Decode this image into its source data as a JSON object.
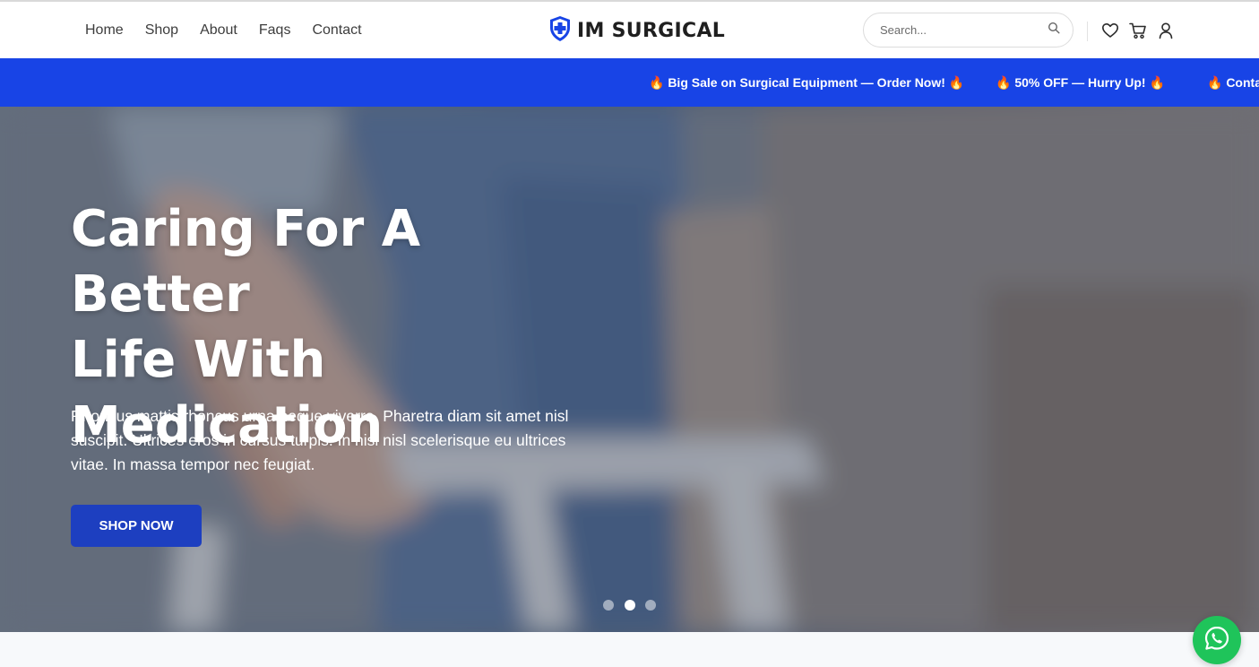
{
  "header": {
    "nav": [
      "Home",
      "Shop",
      "About",
      "Faqs",
      "Contact"
    ],
    "logo_text": "IM SURGICAL",
    "search_placeholder": "Search..."
  },
  "marquee": {
    "items": [
      "🔥 Big Sale on Surgical Equipment — Order Now! 🔥",
      "🔥 50% OFF — Hurry Up! 🔥",
      "🔥 Conta"
    ]
  },
  "hero": {
    "title_lines": [
      "Caring For A Better",
      "Life With",
      "Medication"
    ],
    "description": "Rhoncus mattis rhoncus urna neque viverra. Pharetra diam sit amet nisl suscipit. Ultrices eros in cursus turpis. In nisi nisl scelerisque eu ultrices vitae. In massa tempor nec feugiat.",
    "button_label": "SHOP NOW",
    "slide_count": 3,
    "active_slide": 2
  },
  "colors": {
    "brand_blue": "#1844e6",
    "button_blue": "#1d3fc0",
    "whatsapp_green": "#1fc45a"
  },
  "icons": [
    "search-icon",
    "heart-icon",
    "cart-icon",
    "user-icon",
    "whatsapp-icon",
    "shield-cross-icon"
  ]
}
